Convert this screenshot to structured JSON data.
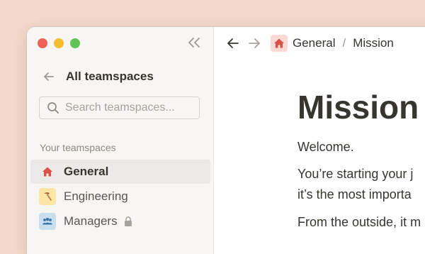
{
  "window": {
    "traffic_lights": [
      "close",
      "minimize",
      "zoom"
    ],
    "colors": {
      "close": "#ee5f57",
      "minimize": "#f5bd30",
      "zoom": "#5fc454"
    }
  },
  "sidebar": {
    "collapse_icon": "double-chevron-left-icon",
    "back_icon": "arrow-left-icon",
    "title": "All teamspaces",
    "search": {
      "placeholder": "Search teamspaces...",
      "value": ""
    },
    "section_label": "Your teamspaces",
    "teamspaces": [
      {
        "label": "General",
        "icon": "house-icon",
        "active": true,
        "locked": false
      },
      {
        "label": "Engineering",
        "icon": "hammer-icon",
        "active": false,
        "locked": false
      },
      {
        "label": "Managers",
        "icon": "people-icon",
        "active": false,
        "locked": true
      }
    ]
  },
  "topbar": {
    "back_icon": "arrow-left-icon",
    "forward_icon": "arrow-right-icon",
    "breadcrumb": [
      {
        "label": "General",
        "icon": "house-icon"
      },
      {
        "label": "Mission"
      }
    ],
    "separator": "/"
  },
  "page": {
    "title": "Mission",
    "paragraphs": [
      "Welcome.",
      "You’re starting your j",
      "it’s the most importa",
      "From the outside, it m"
    ]
  }
}
